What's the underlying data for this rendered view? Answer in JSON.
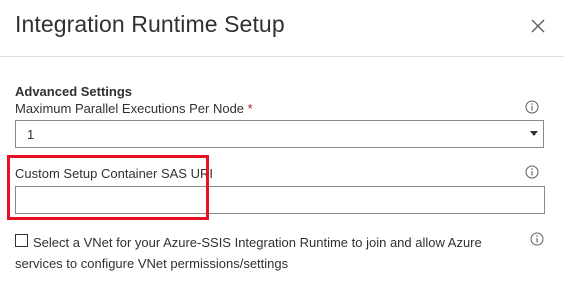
{
  "dialog": {
    "title": "Integration Runtime Setup",
    "close_icon": "close-icon"
  },
  "advanced": {
    "section_title": "Advanced Settings",
    "max_parallel": {
      "label": "Maximum Parallel Executions Per Node",
      "required_mark": "*",
      "value": "1",
      "info_icon": "info-icon"
    },
    "sas_uri": {
      "label": "Custom Setup Container SAS URI",
      "value": "",
      "info_icon": "info-icon"
    },
    "vnet": {
      "checked": false,
      "label": "Select a VNet for your Azure-SSIS Integration Runtime to join and allow Azure services to configure VNet permissions/settings",
      "info_icon": "info-icon"
    }
  },
  "colors": {
    "highlight": "#e81123",
    "required": "#a4262c",
    "border": "#8a8886",
    "text": "#323130"
  }
}
